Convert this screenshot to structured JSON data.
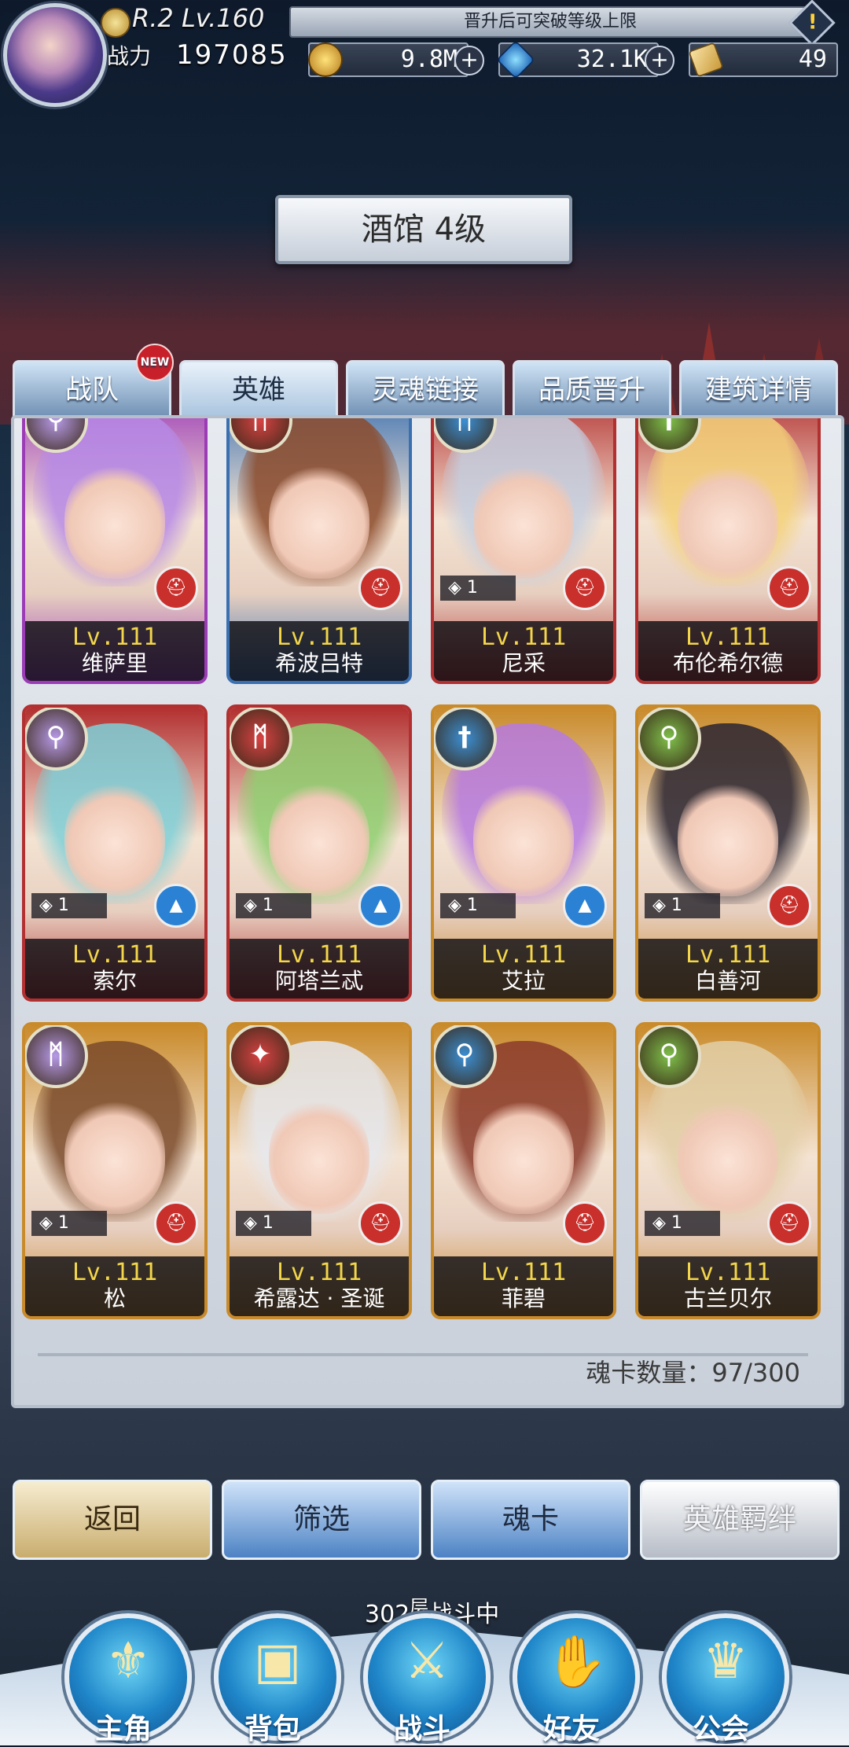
{
  "player": {
    "rank_level": "R.2 Lv.160",
    "power_label": "战力",
    "power_value": "197085",
    "notice": "晋升后可突破等级上限"
  },
  "resources": [
    {
      "icon": "gold-coin-icon",
      "value": "9.8M"
    },
    {
      "icon": "diamond-icon",
      "value": "32.1K"
    },
    {
      "icon": "ticket-icon",
      "value": "49"
    }
  ],
  "building": {
    "title": "酒馆 4级"
  },
  "tabs": [
    {
      "label": "战队",
      "badge": "NEW"
    },
    {
      "label": "英雄"
    },
    {
      "label": "灵魂链接"
    },
    {
      "label": "品质晋升"
    },
    {
      "label": "建筑详情"
    }
  ],
  "heroes": [
    {
      "name": "维萨里",
      "level": "Lv.111",
      "soul": "",
      "class": "magnifier",
      "role": "warrior",
      "frame": "#9b3bb5",
      "hair": "#b78ae6"
    },
    {
      "name": "希波吕特",
      "level": "Lv.111",
      "soul": "",
      "class": "rune",
      "role": "warrior",
      "frame": "#3a6fb0",
      "hair": "#8b4a2a"
    },
    {
      "name": "尼采",
      "level": "Lv.111",
      "soul": "1",
      "class": "rune",
      "role": "warrior",
      "frame": "#b23030",
      "hair": "#c5cfe0"
    },
    {
      "name": "布伦希尔德",
      "level": "Lv.111",
      "soul": "",
      "class": "sword",
      "role": "warrior",
      "frame": "#b23030",
      "hair": "#f4d27a"
    },
    {
      "name": "索尔",
      "level": "Lv.111",
      "soul": "1",
      "class": "magnifier",
      "role": "mage",
      "frame": "#b23030",
      "hair": "#7fd0d8"
    },
    {
      "name": "阿塔兰忒",
      "level": "Lv.111",
      "soul": "1",
      "class": "rune",
      "role": "mage",
      "frame": "#b23030",
      "hair": "#8fcf70"
    },
    {
      "name": "艾拉",
      "level": "Lv.111",
      "soul": "1",
      "class": "sword",
      "role": "mage",
      "frame": "#c98a2a",
      "hair": "#b77ae0"
    },
    {
      "name": "白善河",
      "level": "Lv.111",
      "soul": "1",
      "class": "magnifier",
      "role": "warrior",
      "frame": "#c98a2a",
      "hair": "#2a2430"
    },
    {
      "name": "松",
      "level": "Lv.111",
      "soul": "1",
      "class": "rune",
      "role": "warrior",
      "frame": "#c98a2a",
      "hair": "#7a4a2a"
    },
    {
      "name": "希露达 · 圣诞",
      "level": "Lv.111",
      "soul": "1",
      "class": "wing",
      "role": "warrior",
      "frame": "#c98a2a",
      "hair": "#e6e8ee"
    },
    {
      "name": "菲碧",
      "level": "Lv.111",
      "soul": "",
      "class": "magnifier",
      "role": "warrior",
      "frame": "#c98a2a",
      "hair": "#8a3a2a"
    },
    {
      "name": "古兰贝尔",
      "level": "Lv.111",
      "soul": "1",
      "class": "magnifier",
      "role": "warrior",
      "frame": "#c98a2a",
      "hair": "#e2cfa8"
    }
  ],
  "soul_card_count": "魂卡数量：97/300",
  "actions": {
    "back": "返回",
    "filter": "筛选",
    "soul_card": "魂卡",
    "hero_bond": "英雄羁绊"
  },
  "floor": {
    "number": "302",
    "unit": "层",
    "status": "战斗中"
  },
  "nav": [
    {
      "label": "主角",
      "icon": "hero-helmet-icon"
    },
    {
      "label": "背包",
      "icon": "backpack-icon"
    },
    {
      "label": "战斗",
      "icon": "crossed-swords-icon"
    },
    {
      "label": "好友",
      "icon": "handshake-icon"
    },
    {
      "label": "公会",
      "icon": "guild-crest-icon"
    }
  ]
}
